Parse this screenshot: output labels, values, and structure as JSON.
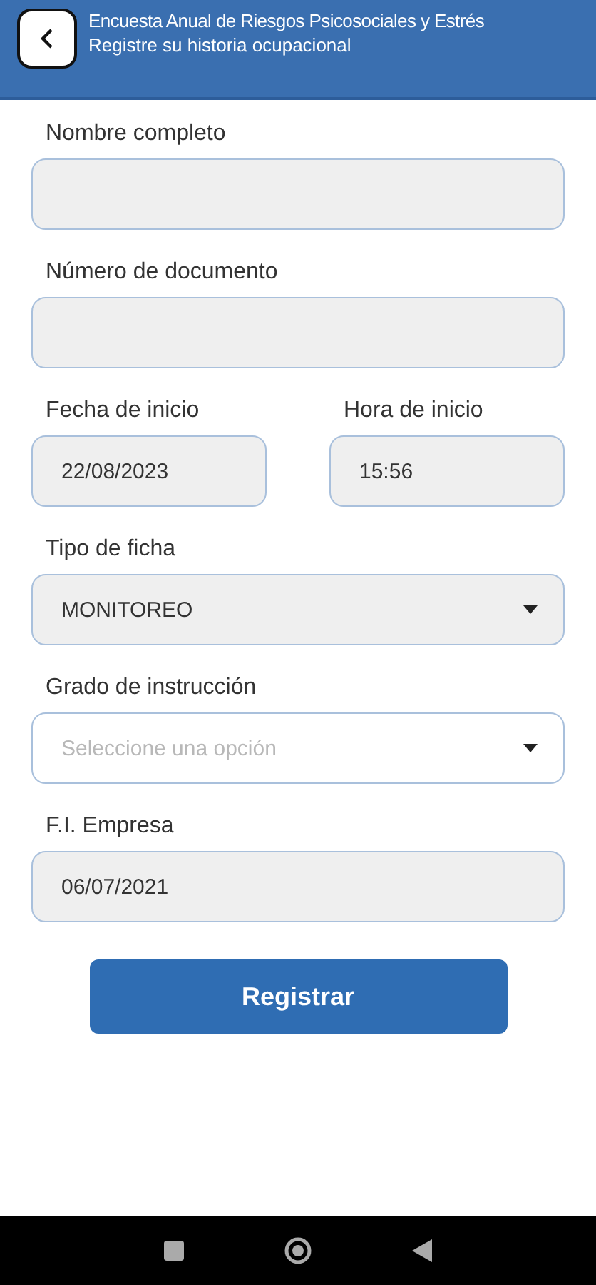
{
  "header": {
    "title": "Encuesta Anual de Riesgos Psicosociales y Estrés",
    "subtitle": "Registre su historia ocupacional"
  },
  "rows": [
    {
      "fields": [
        {
          "kind": "input",
          "label": "Nombre completo",
          "disabled": true
        }
      ]
    },
    {
      "fields": [
        {
          "kind": "input",
          "label": "Número de documento",
          "disabled": true
        }
      ]
    },
    {
      "fields": [
        {
          "kind": "input",
          "label": "Fecha de inicio",
          "value": "22/08/2023",
          "disabled": true
        },
        {
          "kind": "input",
          "label": "Hora de inicio",
          "value": "15:56",
          "disabled": true
        }
      ]
    },
    {
      "fields": [
        {
          "kind": "select",
          "label": "Tipo de ficha",
          "value": "MONITOREO",
          "disabled": true
        }
      ]
    },
    {
      "fields": [
        {
          "kind": "select",
          "label": "Grado de instrucción",
          "placeholder": "Seleccione una opción",
          "disabled": false
        }
      ]
    },
    {
      "fields": [
        {
          "kind": "input",
          "label": "F.I. Empresa",
          "value": "06/07/2021",
          "disabled": true
        }
      ]
    }
  ],
  "submit": {
    "label": "Registrar"
  }
}
